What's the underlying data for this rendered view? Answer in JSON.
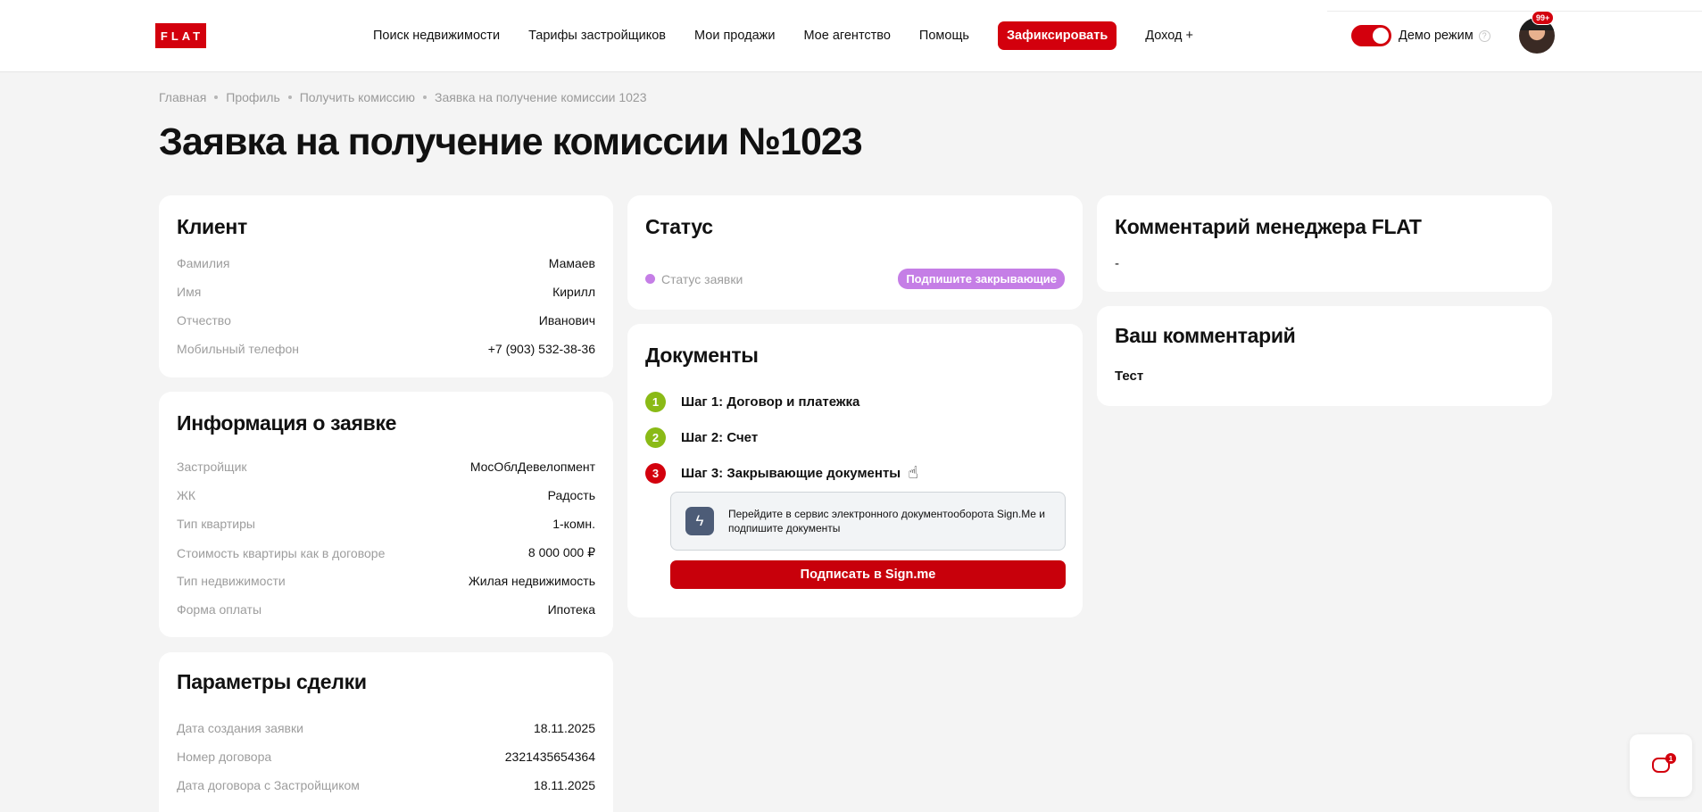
{
  "header": {
    "logo": "FLAT",
    "nav": [
      "Поиск недвижимости",
      "Тарифы застройщиков",
      "Мои продажи",
      "Мое агентство",
      "Помощь"
    ],
    "cta": "Зафиксировать",
    "income": "Доход +",
    "demo_label": "Демо режим",
    "help": "?",
    "badge": "99+"
  },
  "breadcrumb": [
    "Главная",
    "Профиль",
    "Получить комиссию",
    "Заявка на получение комиссии 1023"
  ],
  "page_title": "Заявка на получение комиссии №1023",
  "client": {
    "title": "Клиент",
    "rows": [
      {
        "label": "Фамилия",
        "value": "Мамаев"
      },
      {
        "label": "Имя",
        "value": "Кирилл"
      },
      {
        "label": "Отчество",
        "value": "Иванович"
      },
      {
        "label": "Мобильный телефон",
        "value": "+7 (903) 532-38-36"
      }
    ]
  },
  "info": {
    "title": "Информация о заявке",
    "rows": [
      {
        "label": "Застройщик",
        "value": "МосОблДевелопмент"
      },
      {
        "label": "ЖК",
        "value": "Радость"
      },
      {
        "label": "Тип квартиры",
        "value": "1-комн."
      },
      {
        "label": "Стоимость квартиры как в договоре",
        "value": "8 000 000 ₽"
      },
      {
        "label": "Тип недвижимости",
        "value": "Жилая недвижимость"
      },
      {
        "label": "Форма оплаты",
        "value": "Ипотека"
      }
    ]
  },
  "deal": {
    "title": "Параметры сделки",
    "rows": [
      {
        "label": "Дата создания заявки",
        "value": "18.11.2025"
      },
      {
        "label": "Номер договора",
        "value": "2321435654364"
      },
      {
        "label": "Дата договора с Застройщиком",
        "value": "18.11.2025"
      }
    ]
  },
  "status": {
    "title": "Статус",
    "label": "Статус заявки",
    "value": "Подпишите закрывающие",
    "color": "#c57ee6"
  },
  "documents": {
    "title": "Документы",
    "steps": [
      {
        "num": "1",
        "label": "Шаг 1: Договор и платежка"
      },
      {
        "num": "2",
        "label": "Шаг 2: Счет"
      },
      {
        "num": "3",
        "label": "Шаг 3: Закрывающие документы"
      }
    ],
    "sign_text": "Перейдите в сервис электронного документооборота Sign.Me и подпишите документы",
    "sign_button": "Подписать в Sign.me"
  },
  "manager_comment": {
    "title": "Комментарий менеджера FLAT",
    "text": "-"
  },
  "your_comment": {
    "title": "Ваш комментарий",
    "text": "Тест"
  },
  "chat": {
    "badge": "1"
  },
  "colors": {
    "brand": "#d3000d",
    "step_done": "#8aba16",
    "status": "#c57ee6"
  }
}
